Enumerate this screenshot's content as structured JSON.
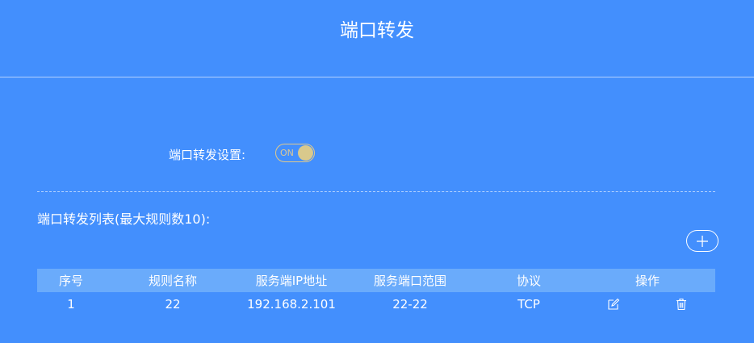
{
  "page": {
    "title": "端口转发"
  },
  "settings": {
    "forward_label": "端口转发设置:",
    "toggle": {
      "text": "ON",
      "state": "on"
    }
  },
  "list": {
    "title": "端口转发列表(最大规则数10):",
    "add_icon": "plus-icon",
    "columns": [
      "序号",
      "规则名称",
      "服务端IP地址",
      "服务端口范围",
      "协议",
      "操作"
    ],
    "rows": [
      {
        "index": "1",
        "name": "22",
        "ip": "192.168.2.101",
        "port_range": "22-22",
        "protocol": "TCP"
      }
    ],
    "row_actions": [
      "edit-icon",
      "delete-icon"
    ]
  },
  "colors": {
    "background": "#438ffd",
    "table_header": "#6aabfb",
    "toggle_accent": "#d9c98c"
  }
}
